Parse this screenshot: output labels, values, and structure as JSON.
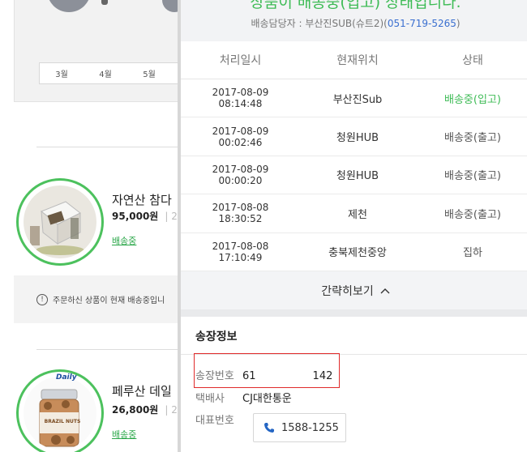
{
  "background": {
    "months": [
      "3월",
      "4월",
      "5월"
    ],
    "products": [
      {
        "name": "자연산 참다",
        "price": "95,000원",
        "sep": "| 2",
        "status": "배송중"
      },
      {
        "name": "페루산 데일",
        "price": "26,800원",
        "sep": "| 2",
        "status": "배송중"
      }
    ],
    "notice": "주문하신 상품이 현재 배송중입니",
    "notice_icon": "!",
    "product_label": "BRAZIL NUTS",
    "brand_label": "Daily"
  },
  "panel": {
    "status_title": "상품이 배송중(입고) 상태입니다.",
    "manager_prefix": "배송담당자 : 부산진SUB(슈트2)(",
    "manager_phone": "051-719-5265",
    "manager_suffix": ")",
    "table": {
      "headers": [
        "처리일시",
        "현재위치",
        "상태"
      ],
      "rows": [
        {
          "date": "2017-08-09",
          "time": "08:14:48",
          "location": "부산진Sub",
          "status": "배송중(입고)",
          "active": true
        },
        {
          "date": "2017-08-09",
          "time": "00:02:46",
          "location": "청원HUB",
          "status": "배송중(출고)",
          "active": false
        },
        {
          "date": "2017-08-09",
          "time": "00:00:20",
          "location": "청원HUB",
          "status": "배송중(출고)",
          "active": false
        },
        {
          "date": "2017-08-08",
          "time": "18:30:52",
          "location": "제천",
          "status": "배송중(출고)",
          "active": false
        },
        {
          "date": "2017-08-08",
          "time": "17:10:49",
          "location": "충북제천중앙",
          "status": "집하",
          "active": false
        }
      ]
    },
    "collapse_label": "간략히보기",
    "collapse_icon": "chevron-up-icon",
    "invoice": {
      "title": "송장정보",
      "number_label": "송장번호",
      "number_value_a": "61",
      "number_value_b": "142",
      "courier_label": "택배사",
      "courier_value": "CJ대한통운",
      "phone_label": "대표번호",
      "phone_value": "1588-1255"
    },
    "colors": {
      "accent_green": "#3dbb55",
      "link_blue": "#3a6fd0",
      "highlight_red": "#e02b2b"
    }
  }
}
